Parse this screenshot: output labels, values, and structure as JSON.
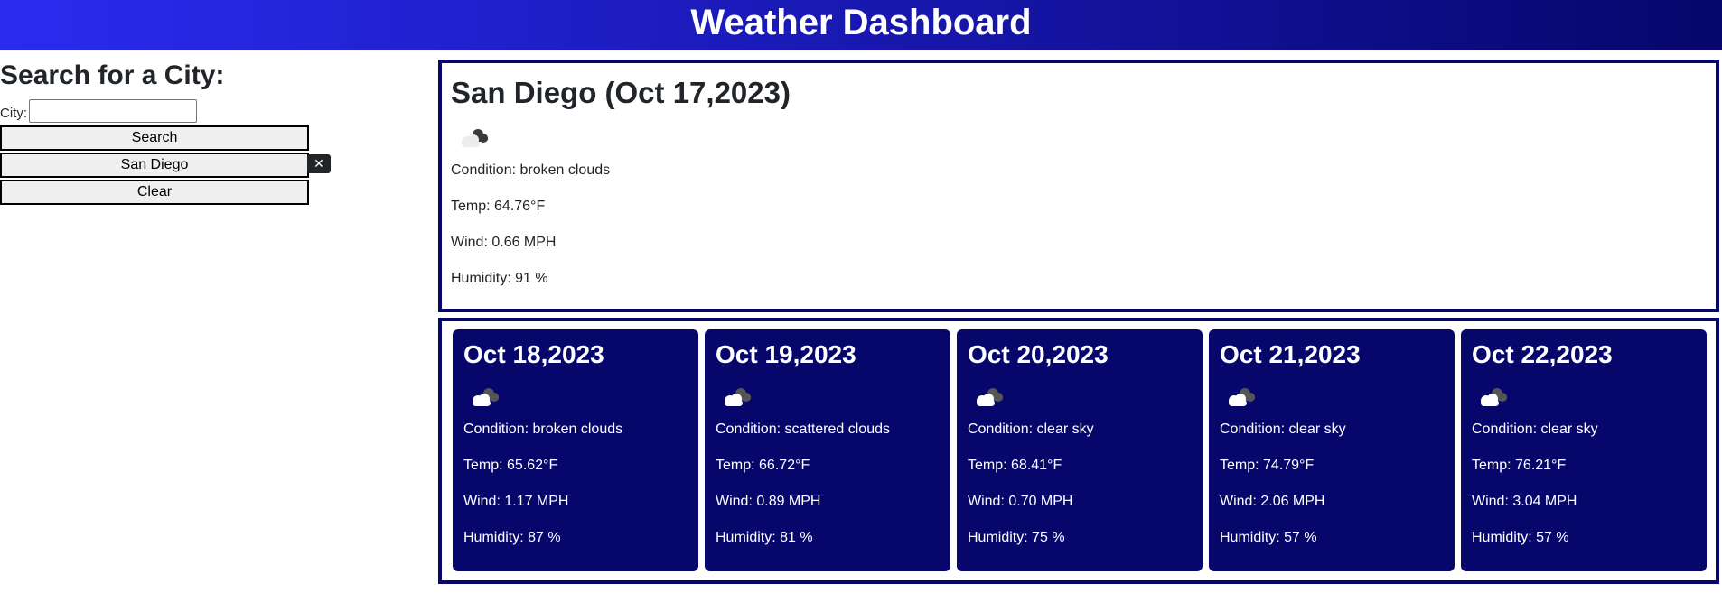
{
  "header": {
    "title": "Weather Dashboard"
  },
  "sidebar": {
    "heading": "Search for a City:",
    "city_label": "City:",
    "city_input_value": "",
    "search_label": "Search",
    "history": [
      {
        "label": "San Diego",
        "remove_label": "✕"
      }
    ],
    "clear_label": "Clear"
  },
  "current": {
    "title": "San Diego (Oct 17,2023)",
    "icon": "broken-clouds-icon",
    "condition": "Condition: broken clouds",
    "temp": "Temp: 64.76°F",
    "wind": "Wind: 0.66 MPH",
    "humidity": "Humidity: 91 %"
  },
  "forecast": [
    {
      "date": "Oct 18,2023",
      "icon": "broken-clouds-icon",
      "condition": "Condition: broken clouds",
      "temp": "Temp: 65.62°F",
      "wind": "Wind: 1.17 MPH",
      "humidity": "Humidity: 87 %"
    },
    {
      "date": "Oct 19,2023",
      "icon": "scattered-clouds-icon",
      "condition": "Condition: scattered clouds",
      "temp": "Temp: 66.72°F",
      "wind": "Wind: 0.89 MPH",
      "humidity": "Humidity: 81 %"
    },
    {
      "date": "Oct 20,2023",
      "icon": "cloud-icon",
      "condition": "Condition: clear sky",
      "temp": "Temp: 68.41°F",
      "wind": "Wind: 0.70 MPH",
      "humidity": "Humidity: 75 %"
    },
    {
      "date": "Oct 21,2023",
      "icon": "cloud-icon",
      "condition": "Condition: clear sky",
      "temp": "Temp: 74.79°F",
      "wind": "Wind: 2.06 MPH",
      "humidity": "Humidity: 57 %"
    },
    {
      "date": "Oct 22,2023",
      "icon": "cloud-icon",
      "condition": "Condition: clear sky",
      "temp": "Temp: 76.21°F",
      "wind": "Wind: 3.04 MPH",
      "humidity": "Humidity: 57 %"
    }
  ],
  "colors": {
    "navy": "#06066b",
    "header_start": "#2b2bf0",
    "header_end": "#06066b"
  }
}
